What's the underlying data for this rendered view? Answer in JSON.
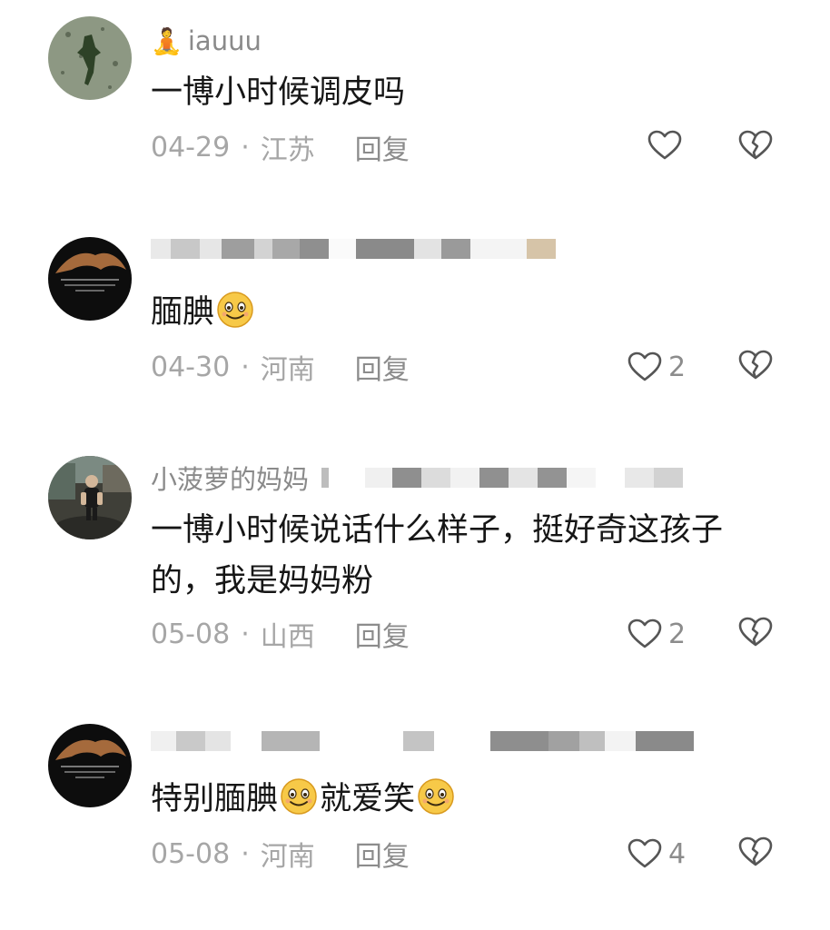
{
  "comments": [
    {
      "username": "iauuu",
      "user_emoji": "🧘",
      "text": "一博小时候调皮吗",
      "date": "04-29",
      "location": "江苏",
      "reply_label": "回复",
      "likes": ""
    },
    {
      "username": "",
      "text_before": "腼腆",
      "text_after": "",
      "date": "04-30",
      "location": "河南",
      "reply_label": "回复",
      "likes": "2"
    },
    {
      "username": "小菠萝的妈妈",
      "text": "一博小时候说话什么样子，挺好奇这孩子的，我是妈妈粉",
      "date": "05-08",
      "location": "山西",
      "reply_label": "回复",
      "likes": "2"
    },
    {
      "username": "",
      "text_part1": "特别腼腆",
      "text_part2": "就爱笑",
      "date": "05-08",
      "location": "河南",
      "reply_label": "回复",
      "likes": "4"
    }
  ],
  "separator": "·",
  "icons": {
    "like": "heart-outline-icon",
    "dislike": "broken-heart-icon",
    "emoji": "smile-emoji-icon"
  },
  "colors": {
    "meta_text": "#a6a6a6",
    "icon_stroke": "#555555",
    "emoji_face": "#f7c948"
  }
}
